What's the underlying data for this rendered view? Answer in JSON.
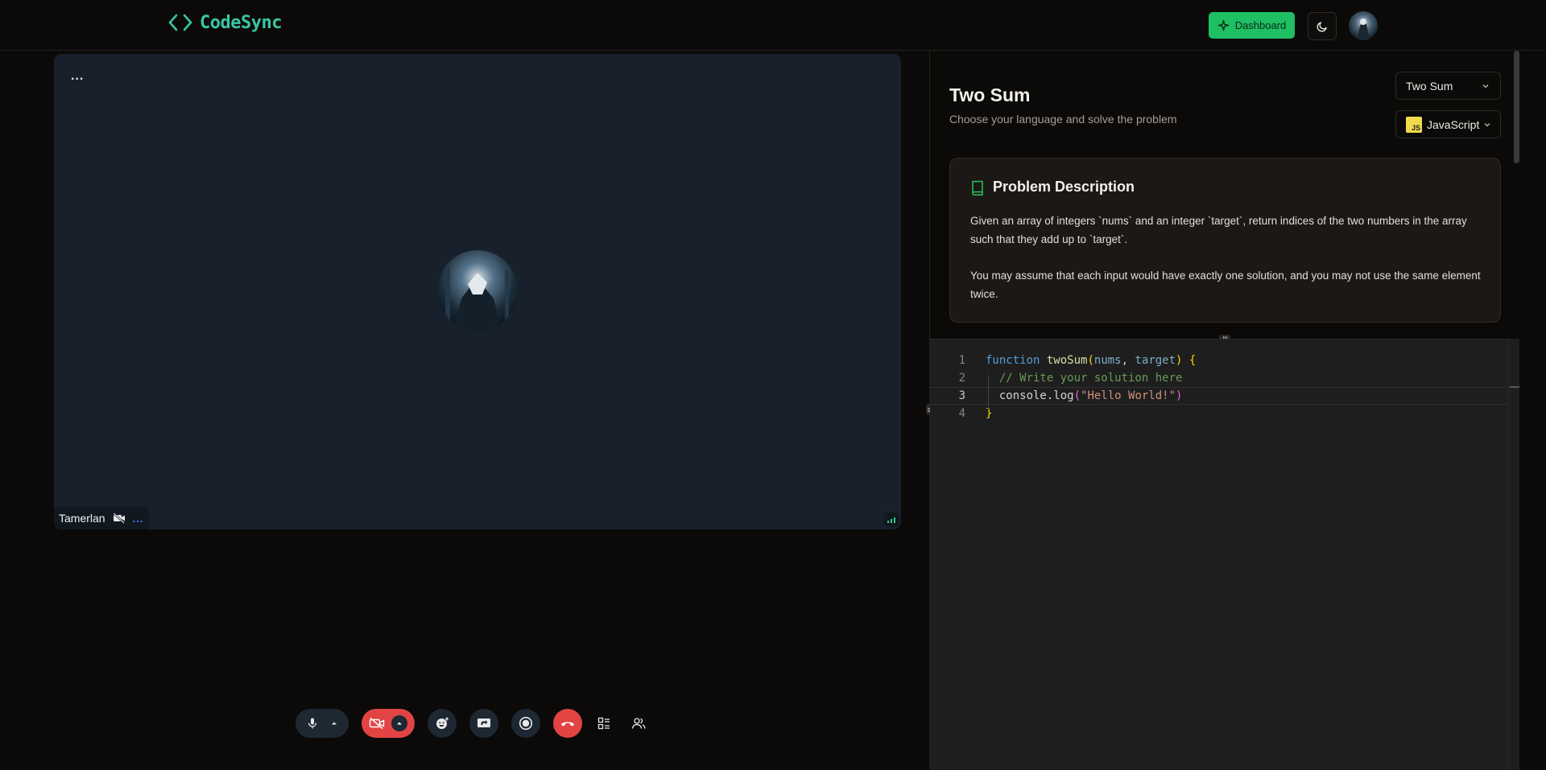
{
  "header": {
    "logo_text": "CodeSync",
    "dashboard_label": "Dashboard"
  },
  "call": {
    "participant_name": "Tamerlan",
    "tile_menu": "...",
    "participant_menu": "..."
  },
  "problem": {
    "title": "Two Sum",
    "subtitle": "Choose your language and solve the problem",
    "problem_select": "Two Sum",
    "language_select": "JavaScript",
    "language_badge": "JS",
    "description_heading": "Problem Description",
    "description_p1": "Given an array of integers `nums` and an integer `target`, return indices of the two numbers in the array such that they add up to `target`.",
    "description_p2": "You may assume that each input would have exactly one solution, and you may not use the same element twice."
  },
  "editor": {
    "line_numbers": [
      "1",
      "2",
      "3",
      "4"
    ],
    "line1": {
      "kw": "function",
      "fn": "twoSum",
      "open": "(",
      "p1": "nums",
      "comma": ", ",
      "p2": "target",
      "close": ")",
      "brace": " {"
    },
    "line2": {
      "comment": "// Write your solution here"
    },
    "line3": {
      "obj": "console.log",
      "open": "(",
      "str": "\"Hello World!\"",
      "close": ")"
    },
    "line4": {
      "brace": "}"
    }
  },
  "colors": {
    "accent_green": "#1fbf64",
    "logo_teal": "#38c7a3",
    "danger_red": "#e24444",
    "tile_bg": "#18212b"
  }
}
